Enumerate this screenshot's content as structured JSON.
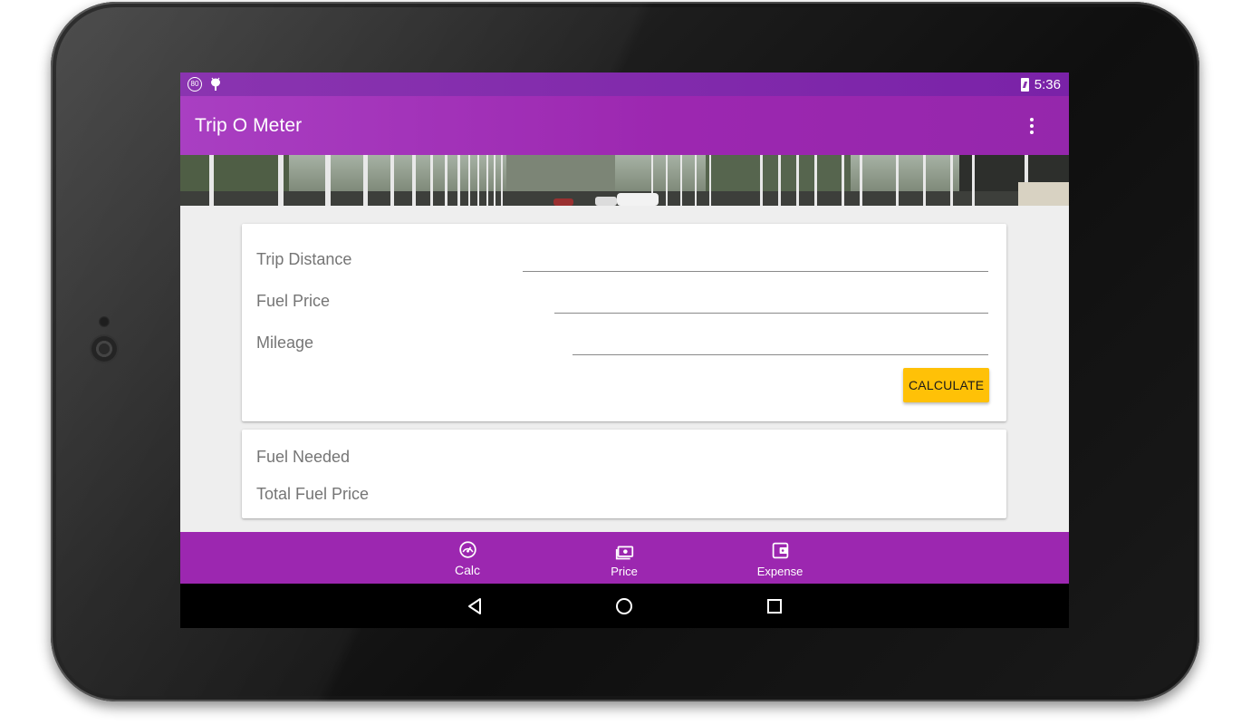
{
  "status_bar": {
    "left_icons": [
      "speed-limit-80-icon",
      "android-debug-icon"
    ],
    "speed_badge": "80",
    "battery_icon": "battery-charging-icon",
    "time": "5:36"
  },
  "app_bar": {
    "title": "Trip O Meter",
    "overflow_icon": "more-vert-icon"
  },
  "form": {
    "trip_distance_label": "Trip Distance",
    "trip_distance_value": "",
    "fuel_price_label": "Fuel Price",
    "fuel_price_value": "",
    "mileage_label": "Mileage",
    "mileage_value": "",
    "calculate_label": "CALCULATE"
  },
  "results": {
    "fuel_needed_label": "Fuel Needed",
    "total_fuel_price_label": "Total Fuel Price"
  },
  "bottom_nav": {
    "items": [
      {
        "label": "Calc",
        "icon": "speedometer-icon"
      },
      {
        "label": "Price",
        "icon": "money-icon"
      },
      {
        "label": "Expense",
        "icon": "wallet-icon"
      }
    ]
  },
  "system_nav": {
    "back_icon": "back-triangle-icon",
    "home_icon": "home-circle-icon",
    "recents_icon": "recents-square-icon"
  },
  "colors": {
    "primary": "#9c27b0",
    "primary_dark": "#7b1fa2",
    "accent": "#ffc107",
    "background": "#eeeeee"
  }
}
